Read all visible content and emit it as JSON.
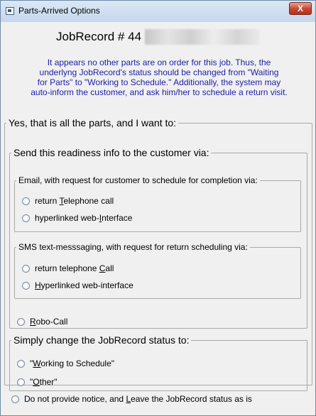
{
  "window": {
    "title": "Parts-Arrived Options",
    "close_label": "X"
  },
  "heading": "JobRecord # 44",
  "info_lines": [
    "It appears no other parts are on order for this job.  Thus, the",
    "underlyng JobRecord's status should be changed from \"Waiting",
    "for Parts\" to \"Working to Schedule.\"  Additionally, the system may",
    "auto-inform the customer, and ask him/her to schedule a return visit."
  ],
  "main_group": {
    "legend": "Yes, that is all the parts, and I want to:"
  },
  "send_group": {
    "legend": "Send this readiness info to the customer via:"
  },
  "email_group": {
    "legend": "Email, with request for customer to schedule for completion via:",
    "opt1": {
      "a": "return ",
      "b": "T",
      "c": "elephone call"
    },
    "opt2": {
      "a": "hyperlinked web-",
      "b": "I",
      "c": "nterface"
    }
  },
  "sms_group": {
    "legend": "SMS text-messsaging, with request for return scheduling via:",
    "opt1": {
      "a": "return telephone ",
      "b": "C",
      "c": "all"
    },
    "opt2": {
      "a": "",
      "b": "H",
      "c": "yperlinked web-interface"
    }
  },
  "robo": {
    "a": "",
    "b": "R",
    "c": "obo-Call"
  },
  "status_group": {
    "legend": "Simply change the JobRecord status to:",
    "opt1": {
      "a": "\"",
      "b": "W",
      "c": "orking to Schedule\""
    },
    "opt2": {
      "a": "\"",
      "b": "O",
      "c": "ther\""
    }
  },
  "bottom": {
    "a": "Do not provide notice, and ",
    "b": "L",
    "c": "eave the JobRecord status as is"
  }
}
